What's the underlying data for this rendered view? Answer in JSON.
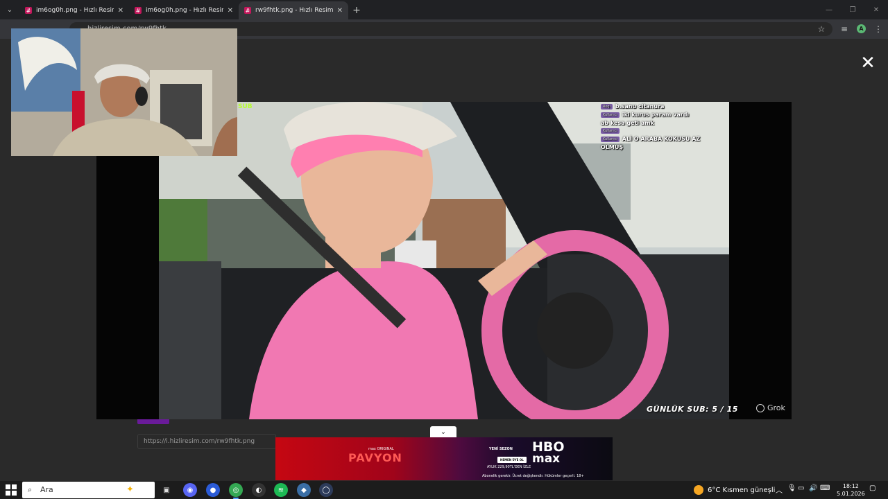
{
  "browser": {
    "tabs": [
      {
        "title": "im6og0h.png - Hızlı Resim",
        "active": false
      },
      {
        "title": "im6og0h.png - Hızlı Resim",
        "active": false
      },
      {
        "title": "rw9fhtk.png - Hızlı Resim",
        "active": true
      }
    ],
    "url": "hizliresim.com/rw9fhtk",
    "profile_initial": "A"
  },
  "page": {
    "link_field": "https://i.hizliresim.com/rw9fhtk.png"
  },
  "overlay": {
    "green_label": "SUB",
    "chat": [
      {
        "user": "Roqi",
        "text": "b.sanu citanura"
      },
      {
        "user": "Kullanıcı",
        "text": "iki kurus param vardı"
      },
      {
        "user": "",
        "text": "ab kesa geti amk"
      },
      {
        "user": "Kullanıcı",
        "text": ""
      },
      {
        "user": "Kullanıcı",
        "text": "ALİ O ARABA KOKUSU AZ"
      },
      {
        "user": "",
        "text": "OLMUŞ"
      }
    ],
    "sub_counter": "GÜNLÜK SUB: 5 / 15",
    "grok": "Grok"
  },
  "ad": {
    "small_brand": "max ORIGINAL",
    "show": "PAVYON",
    "yeni_sezon": "YENİ SEZON",
    "hbo": "HBO",
    "max": "max",
    "cta": "HEMEN ÜYE OL",
    "price": "AYLIK 229,90TL'DEN İZLE",
    "legal": "Abonelik gerekir. Ücret değişkendir. Hükümler geçerli. 18+"
  },
  "taskbar": {
    "search_placeholder": "Ara",
    "weather": "6°C  Kısmen güneşli",
    "time": "18:12",
    "date": "5.01.2026"
  },
  "colors": {
    "brand_pink": "#c2185b",
    "page_bg": "#2a2a2a",
    "sub_green": "#b6ff2d"
  }
}
